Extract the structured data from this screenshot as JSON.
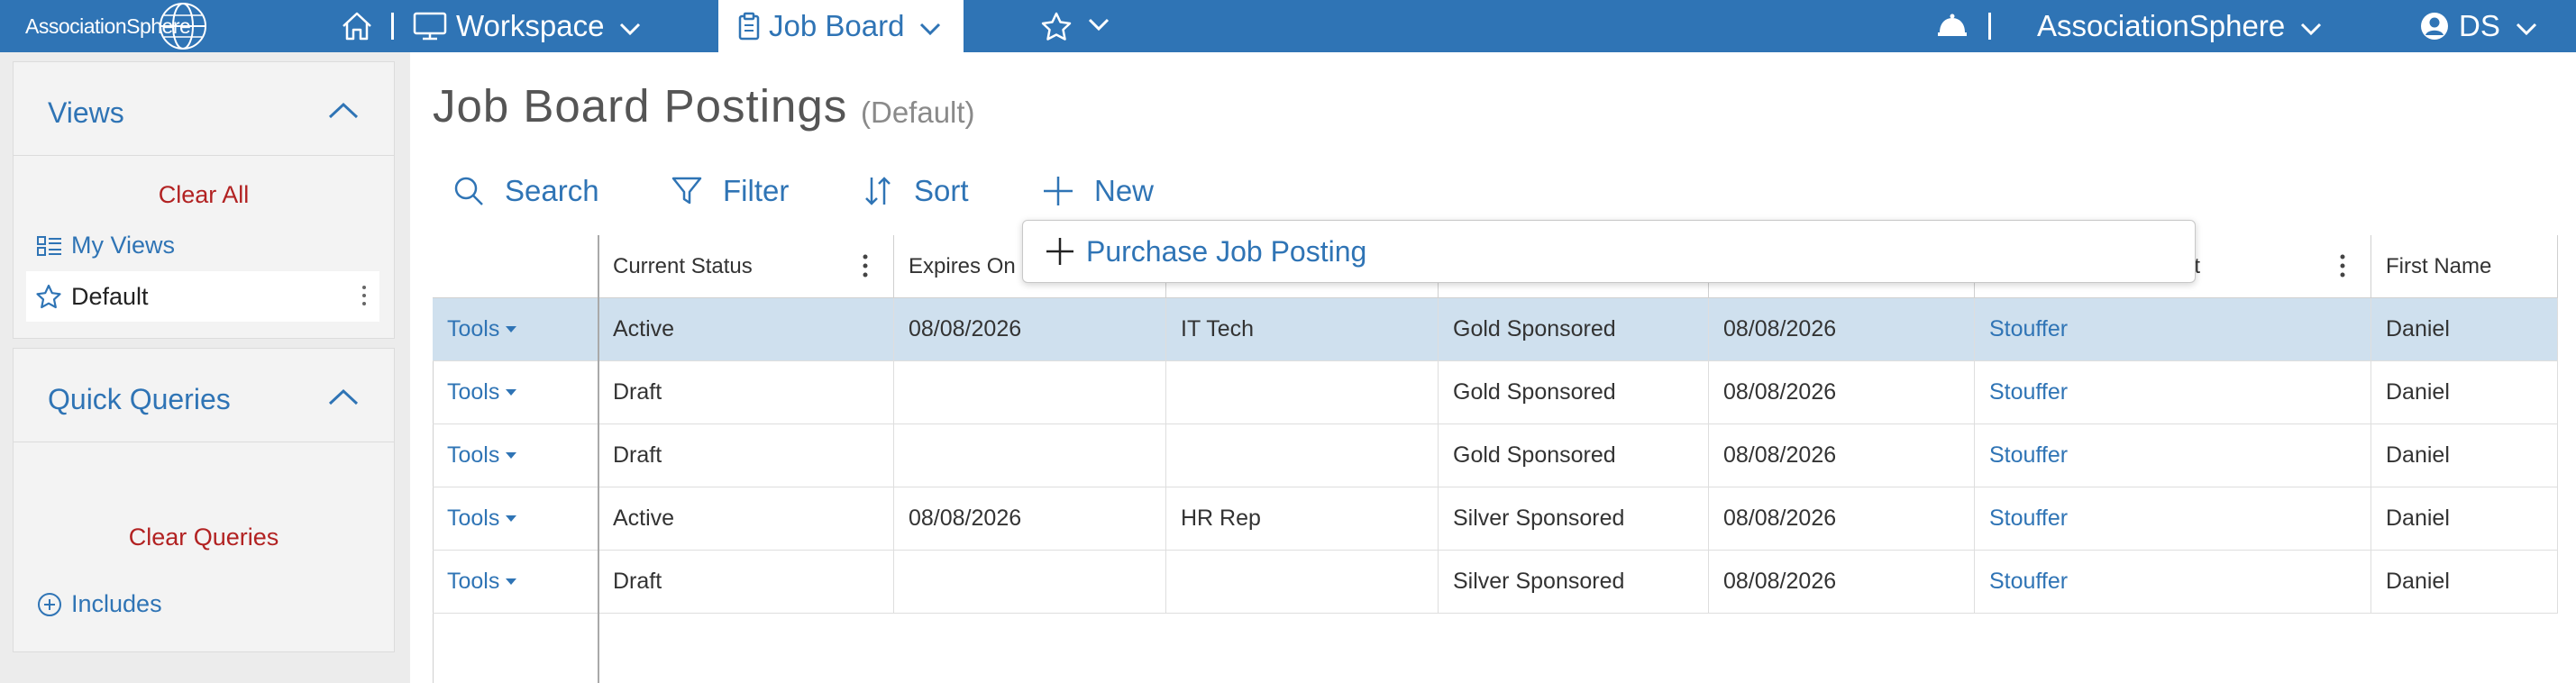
{
  "app": {
    "logo_text": "AssociationSphere",
    "accent_color": "#2f74b5"
  },
  "topnav": {
    "home_icon": "home-icon",
    "workspace_label": "Workspace",
    "job_board_label": "Job Board",
    "favorites_icon": "star-icon",
    "notifications_icon": "bell-icon",
    "org_label": "AssociationSphere",
    "user_initials": "DS"
  },
  "sidebar": {
    "views": {
      "title": "Views",
      "clear_label": "Clear All",
      "my_views_label": "My Views",
      "default_label": "Default"
    },
    "quick_queries": {
      "title": "Quick Queries",
      "clear_label": "Clear Queries",
      "includes_label": "Includes"
    }
  },
  "main": {
    "title": "Job Board Postings",
    "subtitle": "(Default)",
    "toolbar": {
      "search_label": "Search",
      "filter_label": "Filter",
      "sort_label": "Sort",
      "new_label": "New"
    },
    "new_menu": {
      "purchase_label": "Purchase Job Posting"
    },
    "grid": {
      "columns": [
        "",
        "Current Status",
        "Expires On",
        "",
        "",
        "",
        "nt",
        "First Name"
      ],
      "tools_label": "Tools",
      "rows": [
        {
          "status": "Active",
          "expires": "08/08/2026",
          "title": "IT Tech",
          "level": "Gold Sponsored",
          "date": "08/08/2026",
          "contact": "Stouffer",
          "first": "Daniel"
        },
        {
          "status": "Draft",
          "expires": "",
          "title": "",
          "level": "Gold Sponsored",
          "date": "08/08/2026",
          "contact": "Stouffer",
          "first": "Daniel"
        },
        {
          "status": "Draft",
          "expires": "",
          "title": "",
          "level": "Gold Sponsored",
          "date": "08/08/2026",
          "contact": "Stouffer",
          "first": "Daniel"
        },
        {
          "status": "Active",
          "expires": "08/08/2026",
          "title": "HR Rep",
          "level": "Silver Sponsored",
          "date": "08/08/2026",
          "contact": "Stouffer",
          "first": "Daniel"
        },
        {
          "status": "Draft",
          "expires": "",
          "title": "",
          "level": "Silver Sponsored",
          "date": "08/08/2026",
          "contact": "Stouffer",
          "first": "Daniel"
        }
      ]
    }
  }
}
